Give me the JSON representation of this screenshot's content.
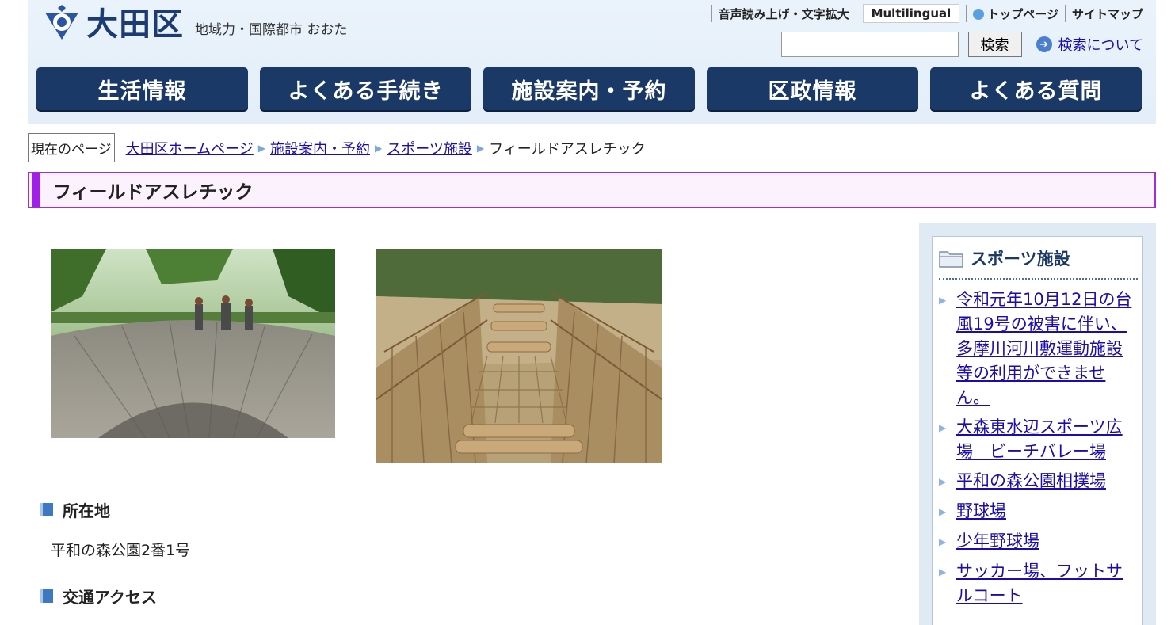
{
  "header": {
    "site_name": "大田区",
    "tagline": "地域力・国際都市 おおた",
    "util": {
      "readspeaker": "音声読み上げ・文字拡大",
      "multilingual": "Multilingual",
      "top_page": "トップページ",
      "sitemap": "サイトマップ"
    },
    "search": {
      "input_value": "",
      "button_label": "検索",
      "help_link": "検索について"
    },
    "nav": [
      {
        "label": "生活情報"
      },
      {
        "label": "よくある手続き"
      },
      {
        "label": "施設案内・予約"
      },
      {
        "label": "区政情報"
      },
      {
        "label": "よくある質問"
      }
    ]
  },
  "breadcrumb": {
    "label": "現在のページ",
    "links": [
      "大田区ホームページ",
      "施設案内・予約",
      "スポーツ施設"
    ],
    "current": "フィールドアスレチック"
  },
  "page": {
    "title": "フィールドアスレチック",
    "sections": [
      {
        "heading": "所在地",
        "text": "平和の森公園2番1号"
      },
      {
        "heading": "交通アクセス"
      }
    ]
  },
  "sidebar": {
    "title": "スポーツ施設",
    "items": [
      {
        "label": "令和元年10月12日の台風19号の被害に伴い、多摩川河川敷運動施設等の利用ができません。"
      },
      {
        "label": "大森東水辺スポーツ広場　ビーチバレー場"
      },
      {
        "label": "平和の森公園相撲場"
      },
      {
        "label": "野球場"
      },
      {
        "label": "少年野球場"
      },
      {
        "label": "サッカー場、フットサルコート"
      }
    ]
  },
  "colors": {
    "nav_bg": "#1b3966",
    "title_accent": "#a020e8",
    "link": "#1a0dab"
  }
}
